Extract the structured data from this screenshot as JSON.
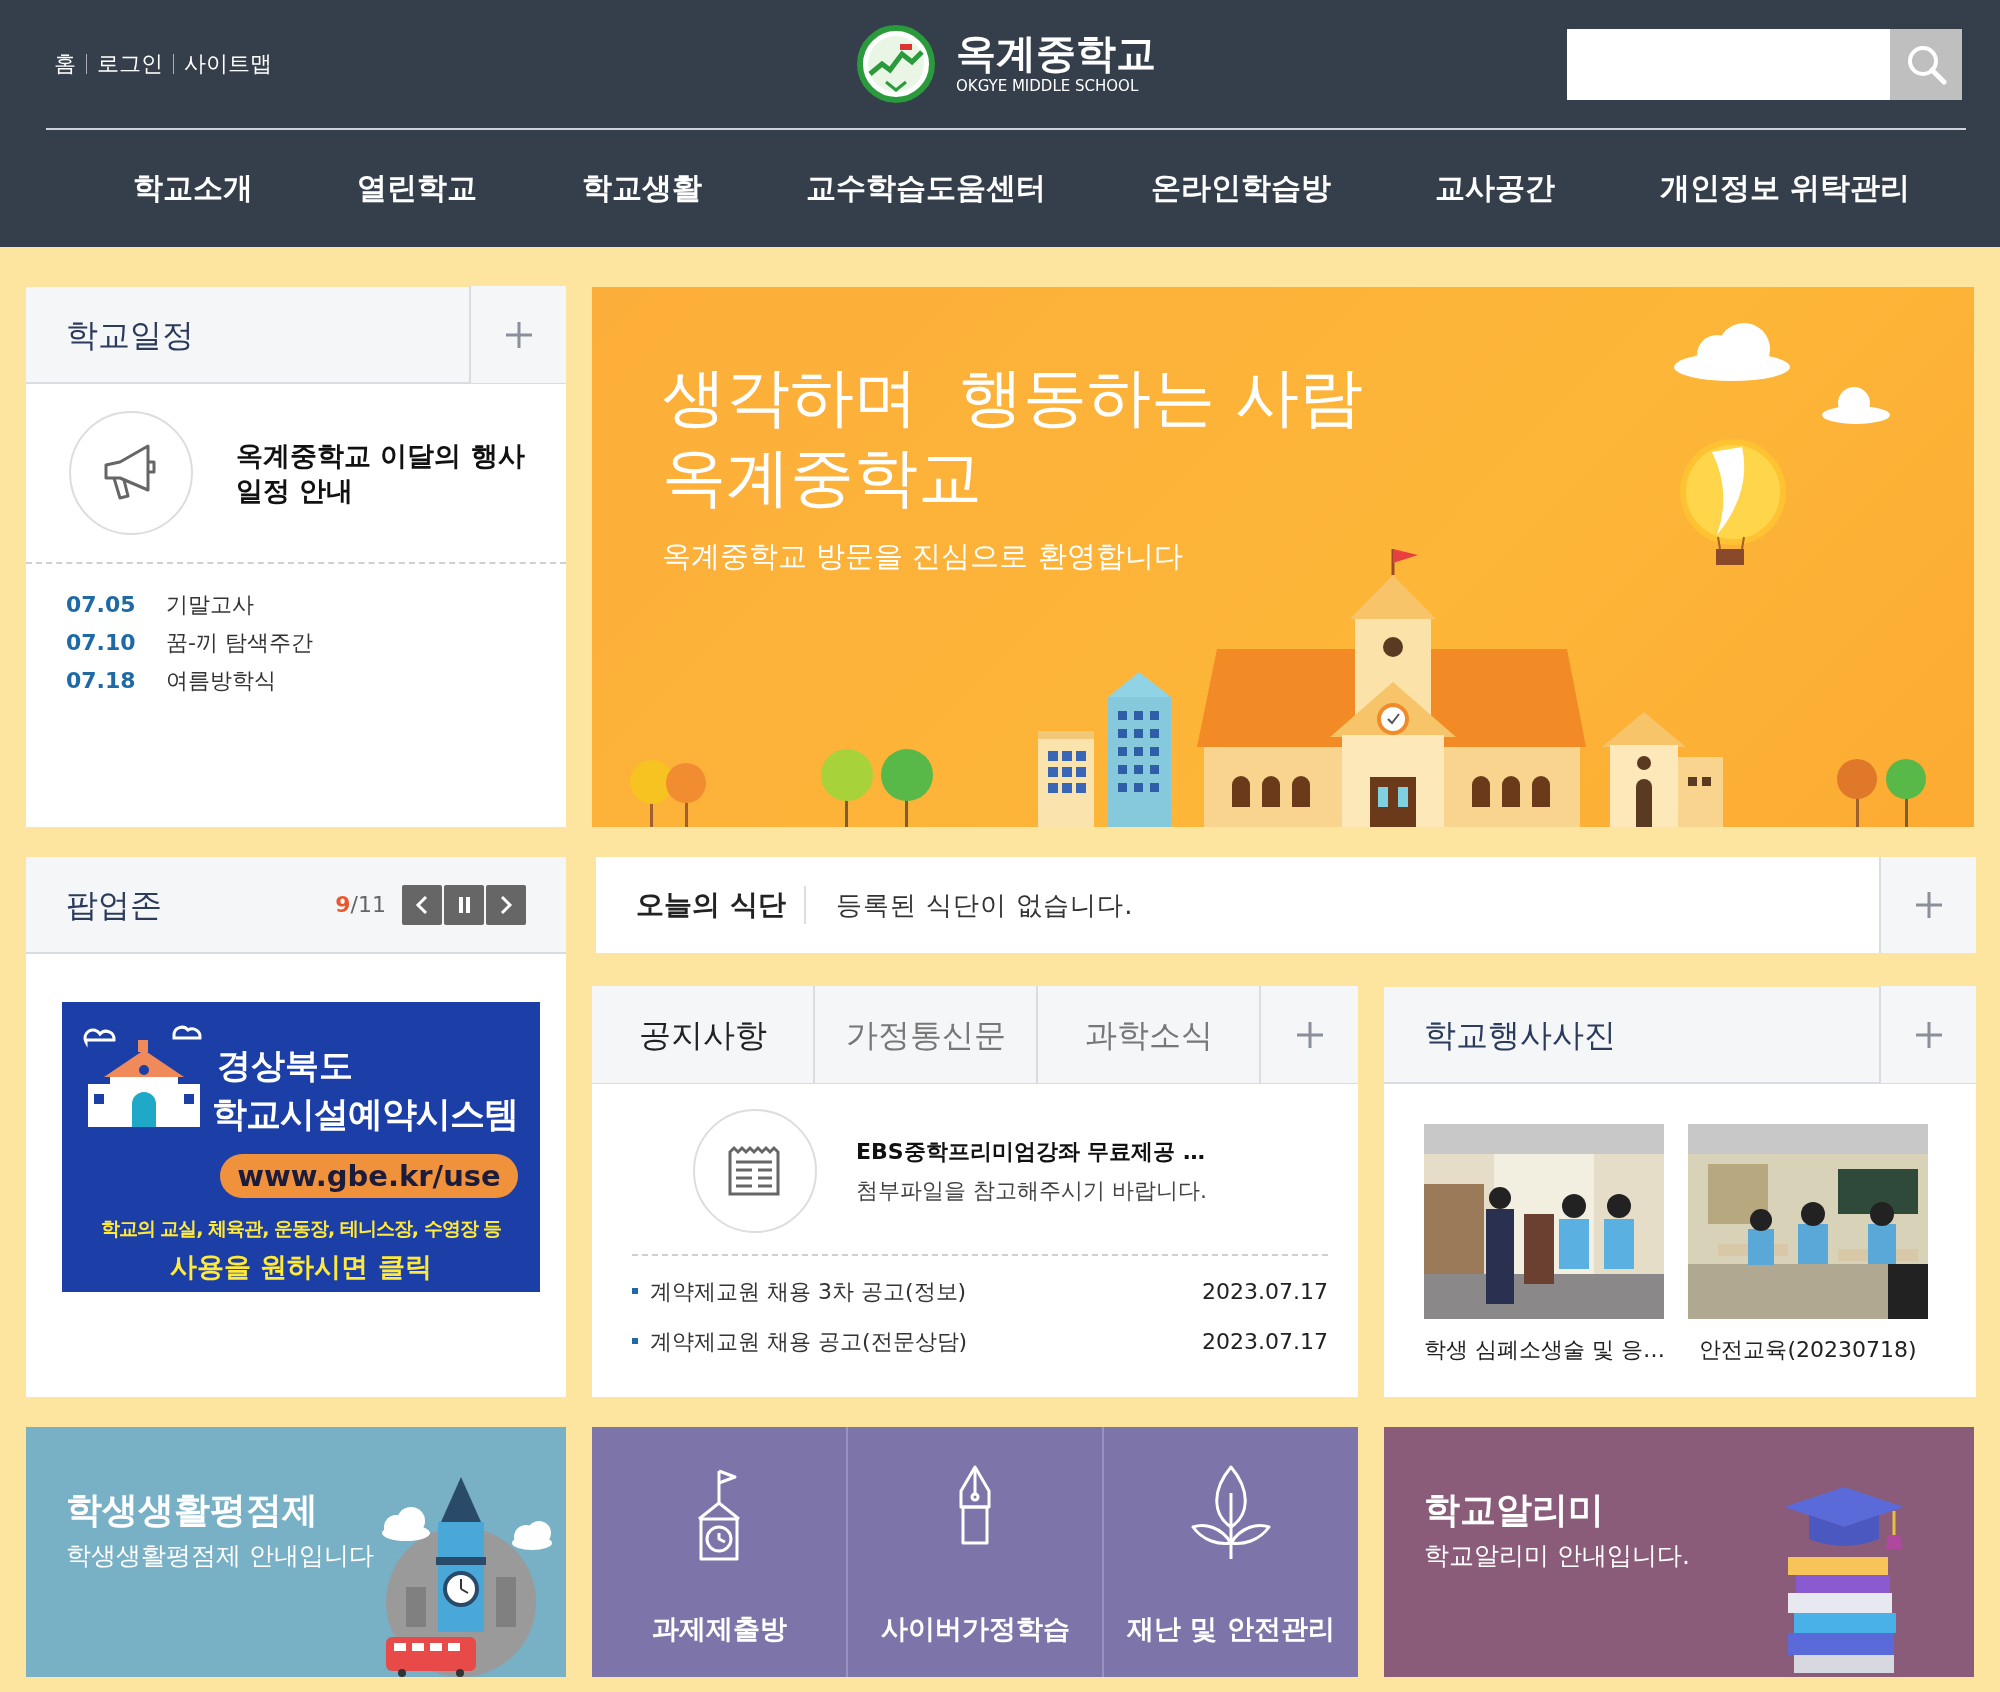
{
  "top_links": [
    {
      "label": "홈"
    },
    {
      "label": "로그인"
    },
    {
      "label": "사이트맵"
    }
  ],
  "logo": {
    "title": "옥계중학교",
    "subtitle": "OKGYE MIDDLE SCHOOL"
  },
  "nav": [
    "학교소개",
    "열린학교",
    "학교생활",
    "교수학습도움센터",
    "온라인학습방",
    "교사공간",
    "개인정보 위탁관리"
  ],
  "schedule": {
    "title": "학교일정",
    "headline": "옥계중학교 이달의 행사 일정 안내",
    "events": [
      {
        "date": "07.05",
        "title": "기말고사"
      },
      {
        "date": "07.10",
        "title": "꿈-끼 탐색주간"
      },
      {
        "date": "07.18",
        "title": "여름방학식"
      }
    ]
  },
  "banner": {
    "headline": [
      "생각하며  행동하는 사람",
      "옥계중학교"
    ],
    "subtitle": "옥계중학교 방문을 진심으로 환영합니다"
  },
  "popup": {
    "title": "팝업존",
    "current": "9",
    "total": "/11",
    "ad": {
      "region": "경상북도",
      "name": "학교시설예약시스템",
      "url": "www.gbe.kr/use",
      "note": "학교의 교실, 체육관, 운동장, 테니스장, 수영장 등",
      "cta": "사용을 원하시면 클릭"
    }
  },
  "meal": {
    "title": "오늘의 식단",
    "text": "등록된 식단이 없습니다."
  },
  "board": {
    "tabs": [
      {
        "label": "공지사항",
        "selected": true
      },
      {
        "label": "가정통신문",
        "selected": false
      },
      {
        "label": "과학소식",
        "selected": false
      }
    ],
    "featured": {
      "title": "EBS중학프리미엄강좌 무료제공 …",
      "summary": "첨부파일을 참고해주시기 바랍니다."
    },
    "posts": [
      {
        "title": "계약제교원 채용 3차 공고(정보)",
        "date": "2023.07.17"
      },
      {
        "title": "계약제교원 채용 공고(전문상담)",
        "date": "2023.07.17"
      }
    ]
  },
  "photos": {
    "title": "학교행사사진",
    "items": [
      {
        "caption": "학생 심폐소생술 및 응…"
      },
      {
        "caption": "안전교육(20230718)"
      }
    ]
  },
  "score_tile": {
    "title": "학생생활평점제",
    "text": "학생생활평점제 안내입니다"
  },
  "quick_links": [
    {
      "kind": "clock-house",
      "label": "과제제출방"
    },
    {
      "kind": "pen",
      "label": "사이버가정학습"
    },
    {
      "kind": "leaf",
      "label": "재난 및 안전관리"
    }
  ],
  "alimi_tile": {
    "title": "학교알리미",
    "text": "학교알리미 안내입니다."
  }
}
